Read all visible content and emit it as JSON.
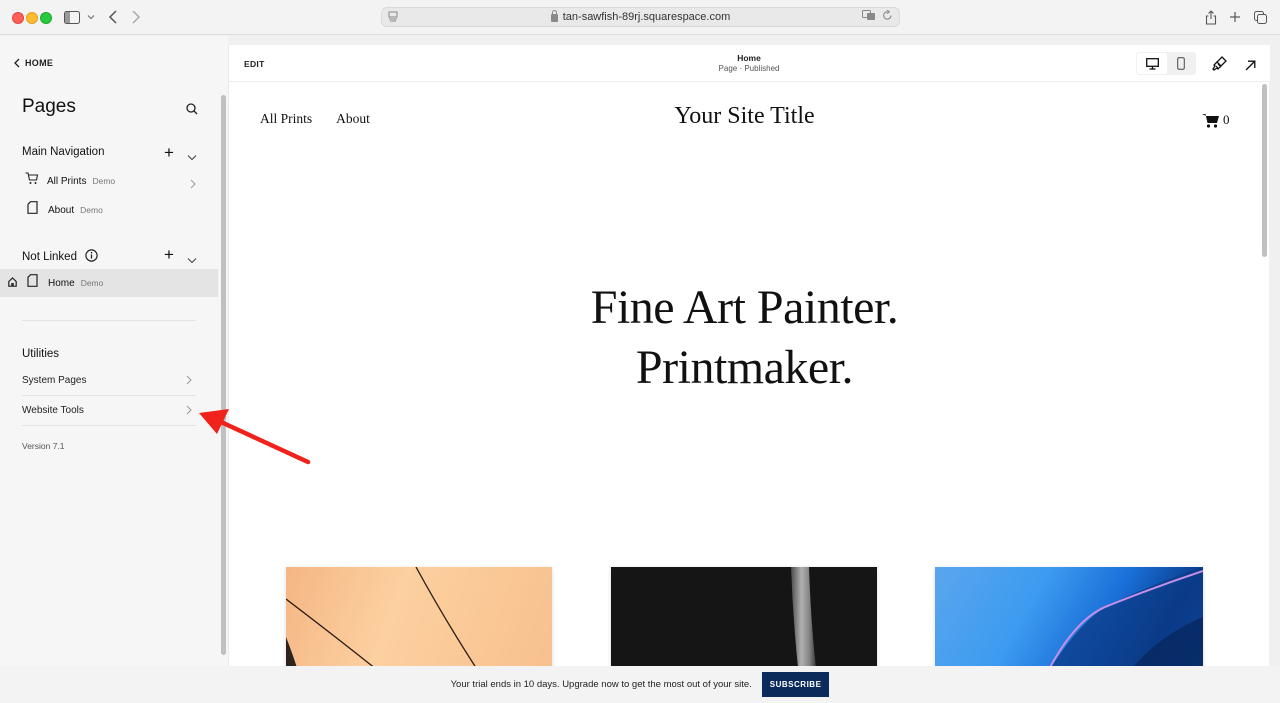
{
  "browser": {
    "url": "tan-sawfish-89rj.squarespace.com",
    "icons": [
      "sidebar-toggle-icon",
      "chevron-down-icon",
      "back-icon",
      "forward-icon",
      "page-menu-icon",
      "lock-icon",
      "translate-icon",
      "reload-icon",
      "share-icon",
      "new-tab-icon",
      "tabs-overview-icon"
    ]
  },
  "sidebar": {
    "back_label": "HOME",
    "title": "Pages",
    "main_navigation": {
      "label": "Main Navigation",
      "items": [
        {
          "label": "All Prints",
          "tag": "Demo",
          "icon": "cart-icon",
          "has_arrow": true
        },
        {
          "label": "About",
          "tag": "Demo",
          "icon": "page-icon",
          "has_arrow": false
        }
      ]
    },
    "not_linked": {
      "label": "Not Linked",
      "items": [
        {
          "label": "Home",
          "tag": "Demo",
          "icon": "page-icon",
          "is_homepage": true,
          "active": true
        }
      ]
    },
    "utilities": {
      "label": "Utilities",
      "items": [
        {
          "label": "System Pages"
        },
        {
          "label": "Website Tools"
        }
      ]
    },
    "version": "Version 7.1"
  },
  "editor": {
    "edit_label": "EDIT",
    "page_title": "Home",
    "page_status": "Page · Published",
    "view_mode": "desktop"
  },
  "site": {
    "nav": [
      "All Prints",
      "About"
    ],
    "title": "Your Site Title",
    "cart_count": "0",
    "hero_line1": "Fine Art Painter.",
    "hero_line2": "Printmaker."
  },
  "banner": {
    "text": "Your trial ends in 10 days. Upgrade now to get the most out of your site.",
    "button": "SUBSCRIBE",
    "button_color": "#0b2c5a"
  },
  "annotation": {
    "color": "#f0221b",
    "points_to": "Website Tools"
  }
}
